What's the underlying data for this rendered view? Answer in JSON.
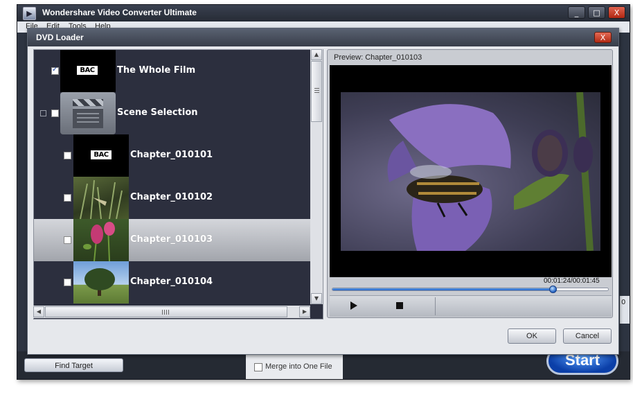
{
  "app": {
    "title": "Wondershare Video Converter Ultimate",
    "menu": [
      "File",
      "Edit",
      "Tools",
      "Help"
    ],
    "window_controls": {
      "minimize": "_",
      "maximize": "□",
      "close": "X"
    },
    "find_target_label": "Find Target",
    "merge_label": "Merge into One File",
    "merge_checked": false,
    "start_label": "Start",
    "side_strip_text": "0"
  },
  "dialog": {
    "title": "DVD Loader",
    "close_label": "X",
    "items": [
      {
        "label": "The Whole Film",
        "checked": true,
        "thumb": "bac-logo",
        "thumb_text": "BAC"
      },
      {
        "label": "Scene Selection",
        "checked": false,
        "thumb": "clapperboard-icon"
      },
      {
        "label": "Chapter_010101",
        "checked": false,
        "thumb": "bac-logo",
        "thumb_text": "BAC"
      },
      {
        "label": "Chapter_010102",
        "checked": false,
        "thumb": "grass-scene"
      },
      {
        "label": "Chapter_010103",
        "checked": false,
        "thumb": "flower-scene",
        "selected": true
      },
      {
        "label": "Chapter_010104",
        "checked": false,
        "thumb": "tree-scene"
      }
    ],
    "preview": {
      "label": "Preview: Chapter_010103",
      "time": "00:01:24/00:01:45",
      "progress": 0.8
    },
    "ok_label": "OK",
    "cancel_label": "Cancel"
  }
}
